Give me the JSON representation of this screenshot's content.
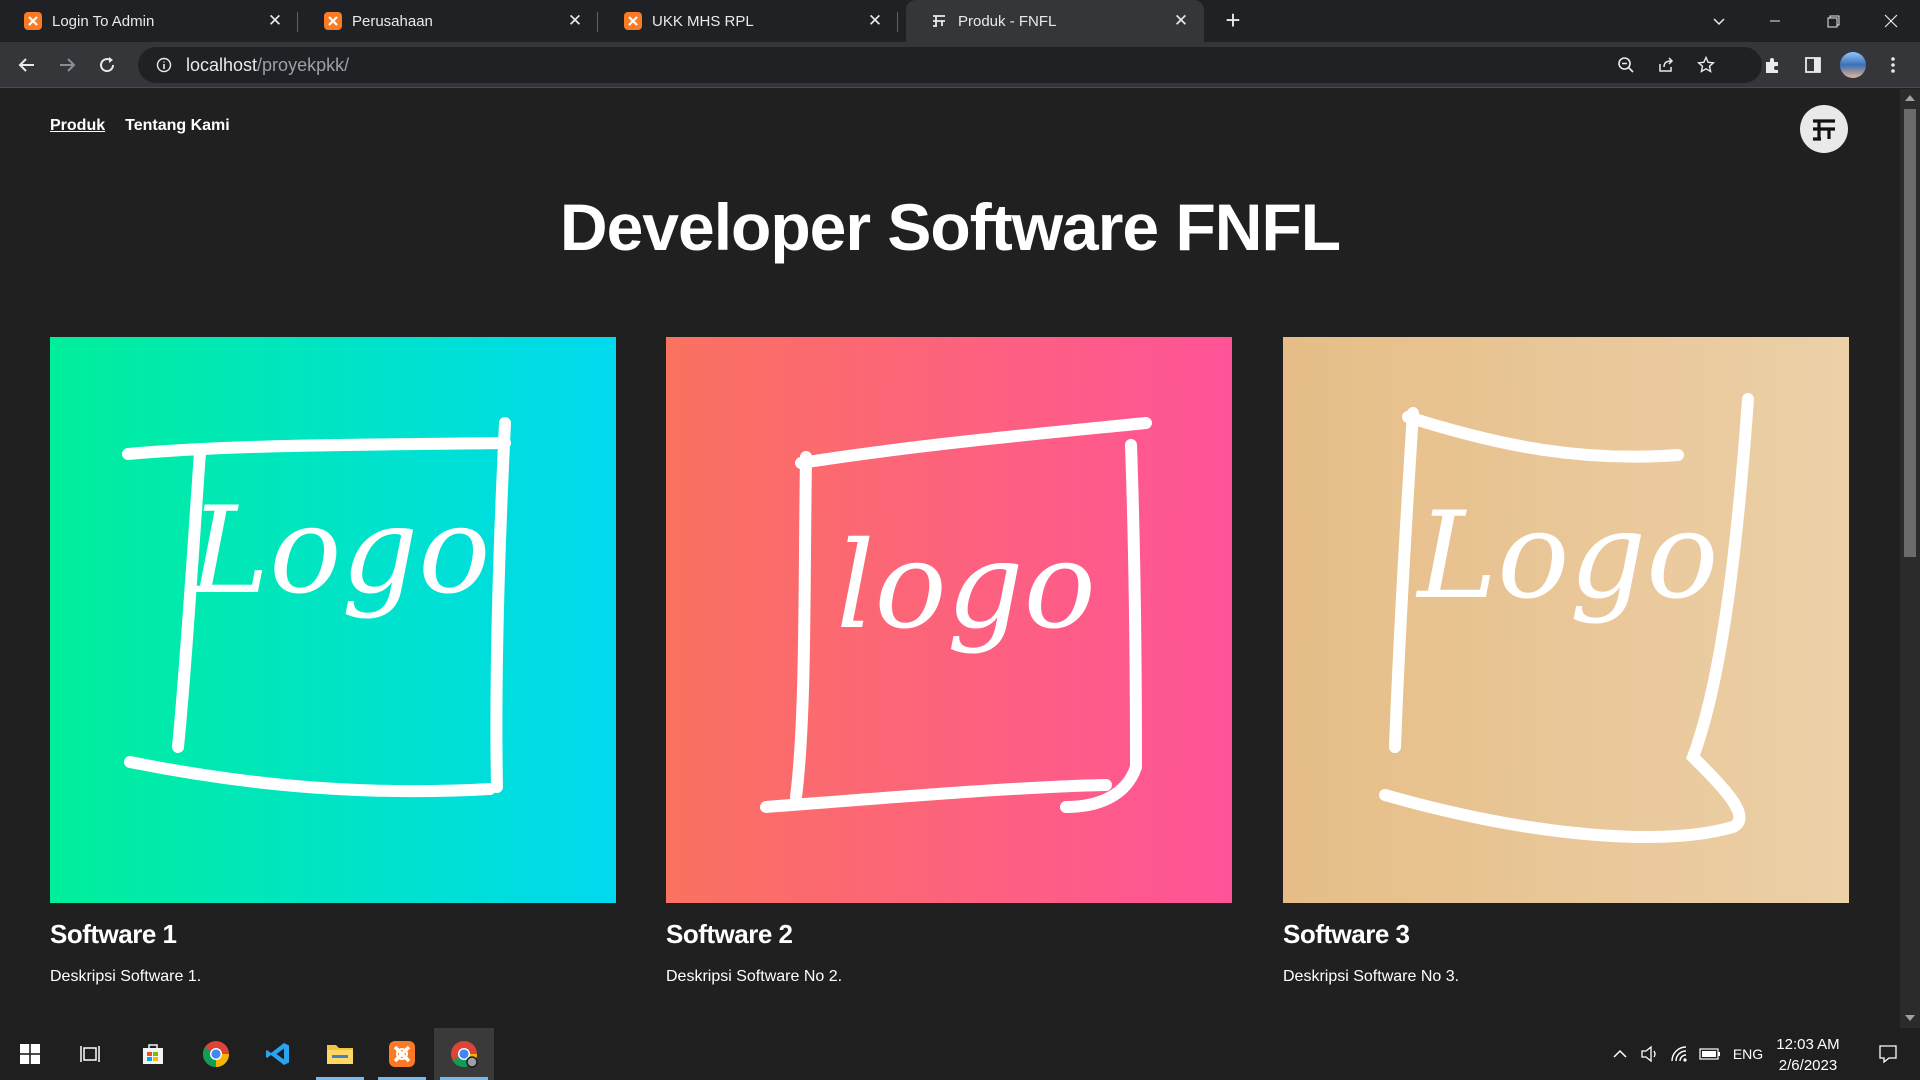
{
  "browser": {
    "tabs": [
      {
        "title": "Login To Admin",
        "favicon": "xampp-icon",
        "active": false
      },
      {
        "title": "Perusahaan",
        "favicon": "xampp-icon",
        "active": false
      },
      {
        "title": "UKK MHS RPL",
        "favicon": "xampp-icon",
        "active": false
      },
      {
        "title": "Produk - FNFL",
        "favicon": "fnfl-icon",
        "active": true
      }
    ],
    "address": {
      "host": "localhost",
      "path": "/proyekpkk/"
    }
  },
  "site": {
    "nav": [
      {
        "label": "Produk",
        "current": true
      },
      {
        "label": "Tentang Kami",
        "current": false
      }
    ],
    "hero_title": "Developer Software FNFL",
    "cards": [
      {
        "title": "Software 1",
        "description": "Deskripsi Software 1.",
        "image_text": "Logo",
        "gradient": [
          "#00ef9a",
          "#00d9ef"
        ]
      },
      {
        "title": "Software 2",
        "description": "Deskripsi Software No 2.",
        "image_text": "logo",
        "gradient": [
          "#fa7260",
          "#ff5398"
        ]
      },
      {
        "title": "Software 3",
        "description": "Deskripsi Software No 3.",
        "image_text": "Logo",
        "gradient": [
          "#e6bd87",
          "#ecd0a8"
        ]
      }
    ]
  },
  "taskbar": {
    "apps": [
      "start-icon",
      "task-view-icon",
      "store-icon",
      "chrome-icon",
      "vscode-icon",
      "file-explorer-icon",
      "xampp-icon",
      "chrome-profile-icon"
    ],
    "language": "ENG",
    "time": "12:03 AM",
    "date": "2/6/2023"
  },
  "colors": {
    "page_bg": "#202020",
    "chrome_dark": "#202124",
    "chrome_toolbar": "#35363a"
  }
}
